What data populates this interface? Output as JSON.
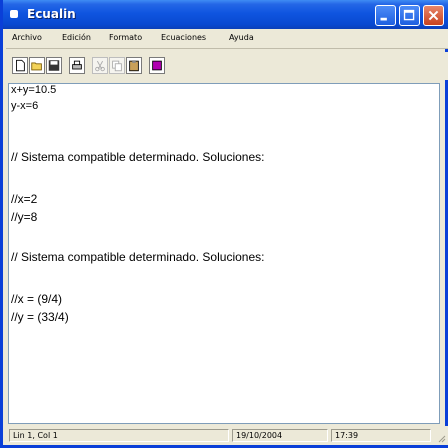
{
  "window": {
    "title": "Ecualin"
  },
  "menu": {
    "items": [
      "Archivo",
      "Edición",
      "Formato",
      "Ecuaciones",
      "Ayuda"
    ]
  },
  "toolbar": {
    "buttons": [
      {
        "icon": "new-document-icon",
        "enabled": true
      },
      {
        "icon": "open-folder-icon",
        "enabled": true
      },
      {
        "icon": "save-disk-icon",
        "enabled": true
      },
      {
        "icon": "print-icon",
        "enabled": true
      },
      {
        "icon": "cut-icon",
        "enabled": false
      },
      {
        "icon": "copy-icon",
        "enabled": false
      },
      {
        "icon": "paste-icon",
        "enabled": true
      },
      {
        "icon": "solve-icon",
        "enabled": true
      }
    ]
  },
  "editor": {
    "lines": [
      "x+y=10.5",
      "y-x=6",
      "// Sistema compatible determinado. Soluciones:",
      "//x=2",
      "//y=8",
      "// Sistema compatible determinado. Soluciones:",
      "//x = (9/4)",
      "//y = (33/4)"
    ]
  },
  "status": {
    "position": "Lin 1, Col 1",
    "date": "19/10/2004",
    "time": "17:39"
  },
  "colors": {
    "title_bar": "#0a4ad8",
    "chrome": "#ece9d8",
    "editor_bg": "#ffffff"
  }
}
